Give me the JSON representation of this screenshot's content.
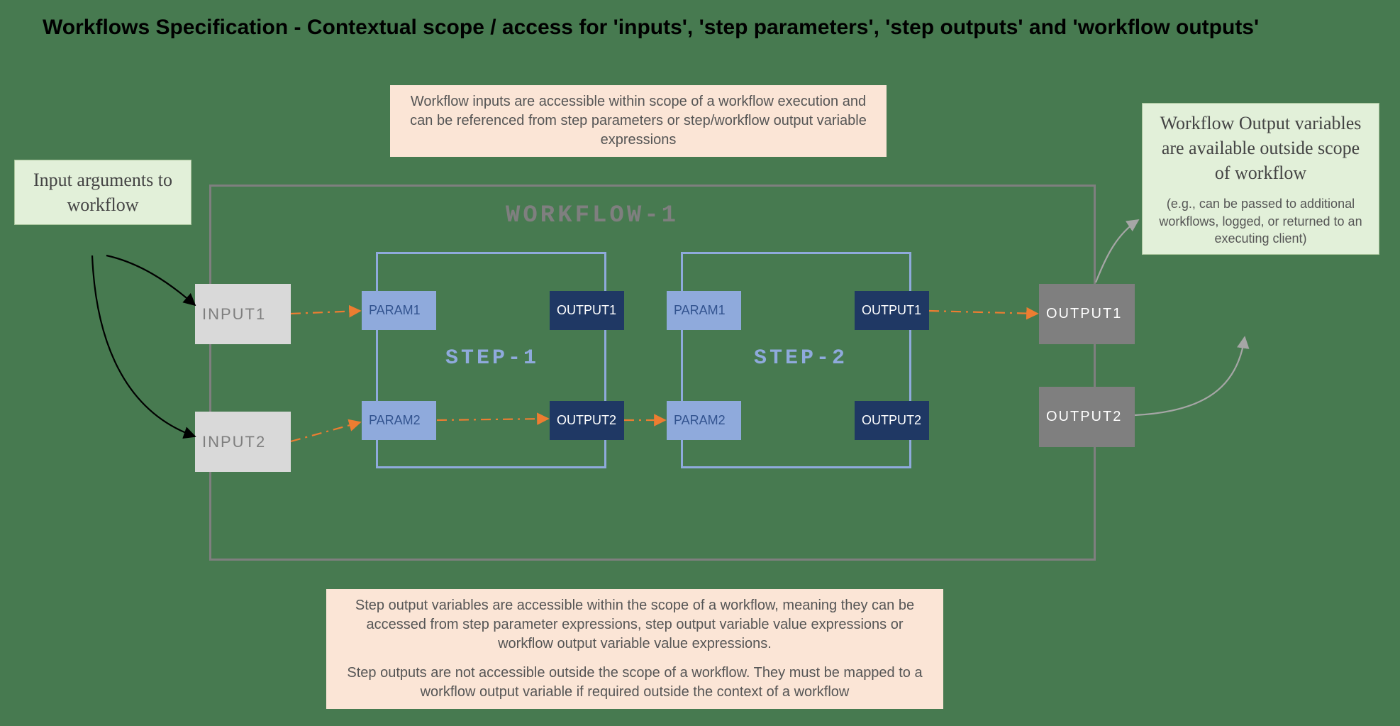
{
  "title": "Workflows Specification - Contextual scope / access for 'inputs', 'step parameters', 'step outputs' and 'workflow outputs'",
  "notes": {
    "top": "Workflow inputs are accessible within scope of a workflow execution and can be referenced from step parameters or step/workflow output variable expressions",
    "left": "Input arguments to workflow",
    "right_main": "Workflow Output variables are available outside scope of workflow",
    "right_sub": "(e.g., can be passed to additional workflows, logged, or returned to an executing client)",
    "bottom_p1": "Step output variables are accessible within the scope of a workflow, meaning they can be accessed from step parameter expressions, step output variable value expressions or workflow output variable value expressions.",
    "bottom_p2": "Step outputs are not accessible outside the scope of a workflow. They must be mapped to a workflow output variable if required outside the context of a workflow"
  },
  "workflow": {
    "title": "WORKFLOW-1",
    "inputs": [
      "INPUT1",
      "INPUT2"
    ],
    "outputs": [
      "OUTPUT1",
      "OUTPUT2"
    ],
    "steps": [
      {
        "title": "STEP-1",
        "params": [
          "PARAM1",
          "PARAM2"
        ],
        "outputs": [
          "OUTPUT1",
          "OUTPUT2"
        ]
      },
      {
        "title": "STEP-2",
        "params": [
          "PARAM1",
          "PARAM2"
        ],
        "outputs": [
          "OUTPUT1",
          "OUTPUT2"
        ]
      }
    ]
  }
}
